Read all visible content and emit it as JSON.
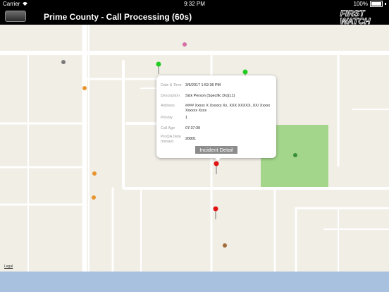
{
  "status_bar": {
    "carrier": "Carrier",
    "time": "9:32 PM",
    "battery": "100%"
  },
  "nav": {
    "title": "Prime County - Call Processing (60s)",
    "logo_line1": "FIRST",
    "logo_line2": "WATCH"
  },
  "map": {
    "legal": "Legal"
  },
  "incident": {
    "date_time_label": "Date & Time",
    "date_time": "3/6/2017 1:52:36 PM",
    "description_label": "Description",
    "description": "Sick Person (Specific Dx)(L1)",
    "address_label": "Address",
    "address": "#### Xxxxx X Xxxxxx Xx, XXX XXXXX, XX/ Xxxxx Xxxxxx Xxxx",
    "priority_label": "Priority",
    "priority": "1",
    "call_age_label": "Call Age",
    "call_age": "07:37:39",
    "proqa_label": "ProQA Dete rminant",
    "proqa": "26801",
    "button": "Incident Detail"
  },
  "colors": {
    "pin_red": "#e01515",
    "pin_green": "#22cc22",
    "park": "#a3d68a",
    "road": "#ffffff",
    "bottom_bar": "#a7c1de"
  }
}
